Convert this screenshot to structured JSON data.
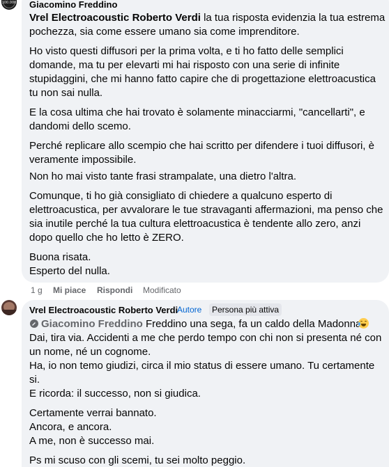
{
  "comment1": {
    "author": "Giacomino Freddino",
    "avatar_text": "100.000",
    "mention": "Vrel Electroacoustic Roberto Verdi",
    "first_line_rest": " la tua risposta evidenzia la tua estrema",
    "line2": "pochezza, sia come essere umano sia come imprenditore.",
    "para2": [
      "Ho visto questi diffusori per la prima volta, e ti ho fatto delle semplici",
      "domande, ma tu per elevarti mi hai risposto con una serie di infinite",
      "stupidaggini, che mi hanno fatto capire che di progettazione elettroacustica",
      "tu non sai nulla."
    ],
    "para3": [
      "E la cosa ultima che hai trovato è solamente minacciarmi, \"cancellarti\", e",
      "dandomi dello scemo."
    ],
    "para4": [
      "Perché replicare allo scempio che hai scritto per difendere i tuoi diffusori, è",
      "veramente impossibile."
    ],
    "para5": "Non ho mai visto tante frasi strampalate, una dietro l'altra.",
    "para6": [
      "Comunque, ti ho già consigliato di chiedere a qualcuno esperto di",
      "elettroacustica, per avvalorare le tue stravaganti affermazioni, ma penso che",
      "sia inutile perché la tua cultura elettroacustica è tendente allo zero, anzi",
      "dopo quello che ho letto è ZERO."
    ],
    "para7": [
      "Buona risata.",
      "Esperto del nulla."
    ],
    "time": "1 g",
    "like": "Mi piace",
    "reply": "Rispondi",
    "edited": "Modificato"
  },
  "comment2": {
    "author": "Vrel Electroacoustic Roberto Verdi",
    "badge_author": "Autore",
    "badge_active": "Persona più attiva",
    "mention": "Giacomino Freddino",
    "first_line_rest": " Freddino una sega, fa un caldo della Madonna.",
    "lines": [
      "Dai, tira via. Accidenti a me che perdo tempo con chi non si presenta né con",
      "un nome, né un cognome.",
      "Ha, io non temo giudizi, circa il mio status di essere umano. Tu certamente",
      "si.",
      "E ricorda: il successo, non si giudica."
    ],
    "lines2": [
      "Certamente verrai bannato.",
      "Ancora, e ancora.",
      "A me, non è successo mai."
    ],
    "last": "Ps mi scuso con gli scemi, tu sei molto peggio."
  },
  "icons": {
    "mention": "verified-page-icon",
    "emoji": "laughing-tears-emoji-icon"
  }
}
